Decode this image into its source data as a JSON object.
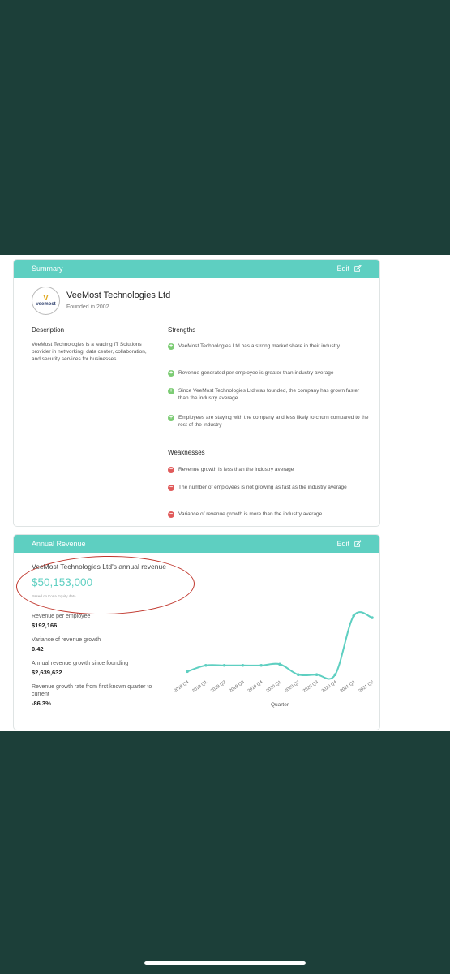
{
  "summary": {
    "header": "Summary",
    "edit_label": "Edit",
    "logo_text": "veemost",
    "company_name": "VeeMost Technologies Ltd",
    "founded": "Founded in 2002",
    "description_title": "Description",
    "description": "VeeMost Technologies is a leading IT Solutions provider in networking, data center, collaboration, and security services for businesses.",
    "strengths_title": "Strengths",
    "strengths": [
      "VeeMost Technologies Ltd has a strong market share in their industry",
      "Revenue generated per employee is greater than industry average",
      "Since VeeMost Technologies Ltd was founded, the company has grown faster than the industry average",
      "Employees are staying with the company and less likely to churn compared to the rest of the industry"
    ],
    "weaknesses_title": "Weaknesses",
    "weaknesses": [
      "Revenue growth is less than the industry average",
      "The number of employees is not growing as fast as the industry average",
      "Variance of revenue growth is more than the industry average"
    ]
  },
  "revenue": {
    "header": "Annual Revenue",
    "edit_label": "Edit",
    "title": "VeeMost Technologies Ltd's annual revenue",
    "amount": "$50,153,000",
    "source": "Based on Kona Equity data",
    "metrics": [
      {
        "label": "Revenue per employee",
        "value": "$192,166"
      },
      {
        "label": "Variance of revenue growth",
        "value": "0.42"
      },
      {
        "label": "Annual revenue growth since founding",
        "value": "$2,639,632"
      },
      {
        "label": "Revenue growth rate from first known quarter to current",
        "value": "-86.3%"
      }
    ]
  },
  "chart_data": {
    "type": "line",
    "xlabel": "Quarter",
    "x": [
      "2018 Q4",
      "2019 Q1",
      "2019 Q2",
      "2019 Q3",
      "2019 Q4",
      "2020 Q1",
      "2020 Q2",
      "2020 Q3",
      "2020 Q4",
      "2021 Q1",
      "2021 Q2"
    ],
    "values": [
      0.1,
      0.2,
      0.2,
      0.2,
      0.2,
      0.22,
      0.05,
      0.05,
      0.05,
      1.0,
      0.97
    ],
    "ylim": [
      0,
      1.05
    ],
    "color": "#5ecfc1"
  }
}
